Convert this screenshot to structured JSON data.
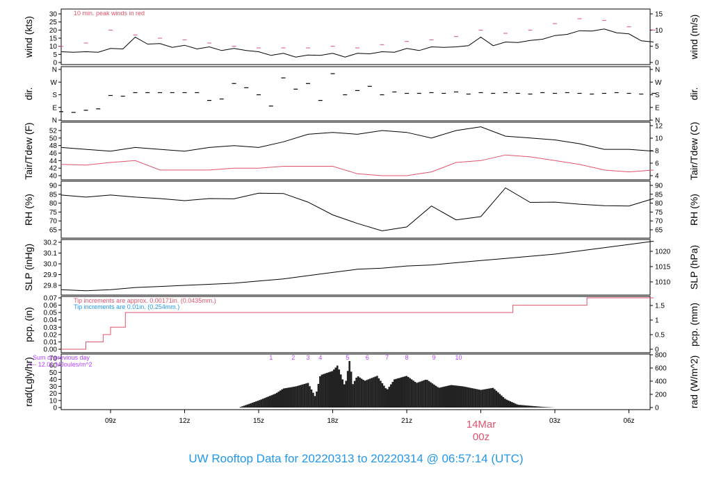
{
  "title": "UW Rooftop Data for 20220313  to  20220314 @ 06:57:14  (UTC)",
  "colors": {
    "black": "#000000",
    "red": "#DF536B",
    "blue": "#2297E6",
    "purple": "#B643FF",
    "title": "#2297E6"
  },
  "chart_data": {
    "type": "line",
    "x_unit": "hours since 2022-03-13 07z",
    "xlim": [
      0,
      24
    ],
    "x_ticks": [
      {
        "h": 2,
        "label": "09z"
      },
      {
        "h": 5,
        "label": "12z"
      },
      {
        "h": 8,
        "label": "15z"
      },
      {
        "h": 11,
        "label": "18z"
      },
      {
        "h": 14,
        "label": "21z"
      },
      {
        "h": 17,
        "label": "00z"
      },
      {
        "h": 20,
        "label": "03z"
      },
      {
        "h": 23,
        "label": "06z"
      }
    ],
    "date_marker": {
      "h": 17,
      "date": "14Mar",
      "time": "00z"
    },
    "panels": [
      {
        "id": "wind",
        "ylabel": "wind (kts)",
        "ylabel_right": "wind (m/s)",
        "left_ticks": [
          "0",
          "5",
          "10",
          "15",
          "20",
          "25",
          "30"
        ],
        "left_values": [
          0,
          5,
          10,
          15,
          20,
          25,
          30
        ],
        "right_ticks": [
          "0",
          "5",
          "10",
          "15"
        ],
        "right_values": [
          0,
          5,
          10,
          15
        ],
        "annotation": "10 min. peak winds in red",
        "series": [
          {
            "name": "wind speed (kts)",
            "color": "black",
            "dx": 0.5,
            "values": [
              6,
              7,
              6,
              7,
              8,
              9,
              15,
              12,
              11,
              10,
              10,
              9,
              9,
              8,
              8,
              8,
              6,
              5,
              5,
              4,
              4,
              5,
              5,
              4,
              5,
              6,
              6,
              7,
              8,
              8,
              9,
              10,
              9,
              11,
              15,
              11,
              12,
              13,
              13,
              15,
              16,
              18,
              19,
              20,
              20,
              19,
              17,
              14,
              12
            ]
          },
          {
            "name": "10 min peak (kts)",
            "color": "red",
            "dx": 1,
            "values": [
              10,
              12,
              20,
              17,
              15,
              14,
              12,
              10,
              9,
              9,
              9,
              10,
              9,
              11,
              13,
              14,
              16,
              20,
              18,
              20,
              24,
              27,
              26,
              22,
              20
            ]
          }
        ]
      },
      {
        "id": "dir",
        "ylabel": "dir.",
        "ylabel_right": "dir.",
        "left_ticks": [
          "N",
          "E",
          "S",
          "W",
          "N"
        ],
        "left_values": [
          0,
          90,
          180,
          270,
          360
        ],
        "right_ticks": [
          "N",
          "E",
          "S",
          "W",
          "N"
        ],
        "right_values": [
          0,
          90,
          180,
          270,
          360
        ],
        "series": [
          {
            "name": "direction (deg)",
            "color": "black",
            "dx": 0.5,
            "values": [
              60,
              55,
              70,
              80,
              175,
              170,
              195,
              195,
              195,
              195,
              195,
              195,
              140,
              150,
              260,
              230,
              180,
              100,
              300,
              220,
              260,
              140,
              330,
              180,
              210,
              240,
              180,
              200,
              190,
              190,
              195,
              190,
              200,
              185,
              195,
              190,
              195,
              190,
              185,
              195,
              190,
              195,
              190,
              185,
              190,
              195,
              190,
              185,
              190
            ]
          }
        ]
      },
      {
        "id": "temp",
        "ylabel": "Tair/Tdew (F)",
        "ylabel_right": "Tair/Tdew (C)",
        "left_ticks": [
          "40",
          "42",
          "44",
          "46",
          "48",
          "50",
          "52"
        ],
        "left_values": [
          40,
          42,
          44,
          46,
          48,
          50,
          52
        ],
        "right_ticks": [
          "4",
          "6",
          "8",
          "10",
          "12"
        ],
        "right_values": [
          4,
          6,
          8,
          10,
          12
        ],
        "series": [
          {
            "name": "Tair (F)",
            "color": "black",
            "dx": 1,
            "values": [
              47.5,
              47,
              46.5,
              47.5,
              47,
              46.5,
              47.5,
              48,
              47.5,
              49,
              51,
              51.5,
              51,
              52,
              51.5,
              50,
              52,
              53,
              50.5,
              50,
              49.5,
              48.5,
              47,
              47,
              46.5
            ]
          },
          {
            "name": "Tdew (F)",
            "color": "red",
            "dx": 1,
            "values": [
              43,
              42.8,
              43.5,
              44,
              41.5,
              41.5,
              41.5,
              42,
              42,
              42.5,
              42.5,
              42.5,
              40.5,
              40,
              40,
              41,
              43.5,
              44,
              45.5,
              45,
              44,
              43,
              41.5,
              41,
              41.5
            ]
          }
        ]
      },
      {
        "id": "rh",
        "ylabel": "RH (%)",
        "ylabel_right": "RH (%)",
        "left_ticks": [
          "65",
          "70",
          "75",
          "80",
          "85",
          "90"
        ],
        "left_values": [
          65,
          70,
          75,
          80,
          85,
          90
        ],
        "right_ticks": [
          "65",
          "70",
          "75",
          "80",
          "85",
          "90"
        ],
        "right_values": [
          65,
          70,
          75,
          80,
          85,
          90
        ],
        "series": [
          {
            "name": "RH (%)",
            "color": "black",
            "dx": 1,
            "values": [
              84,
              84,
              84,
              84,
              82,
              82,
              82,
              83,
              85,
              86,
              80,
              74,
              68,
              65,
              66,
              79,
              70,
              73,
              88,
              81,
              80,
              80,
              78,
              79,
              82
            ]
          }
        ]
      },
      {
        "id": "slp",
        "ylabel": "SLP (inHg)",
        "ylabel_right": "SLP (hPa)",
        "left_ticks": [
          "29.8",
          "29.9",
          "30.0",
          "30.1",
          "30.2"
        ],
        "left_values": [
          29.8,
          29.9,
          30.0,
          30.1,
          30.2
        ],
        "right_ticks": [
          "1010",
          "1015",
          "1020"
        ],
        "right_values": [
          1010,
          1015,
          1020
        ],
        "series": [
          {
            "name": "SLP (inHg)",
            "color": "black",
            "dx": 1,
            "values": [
              29.76,
              29.75,
              29.76,
              29.78,
              29.79,
              29.8,
              29.81,
              29.82,
              29.84,
              29.86,
              29.89,
              29.92,
              29.95,
              29.96,
              29.98,
              29.99,
              30.01,
              30.03,
              30.05,
              30.07,
              30.09,
              30.12,
              30.15,
              30.18,
              30.21
            ]
          }
        ]
      },
      {
        "id": "pcp",
        "ylabel": "pcp. (in)",
        "ylabel_right": "pcp. (mm)",
        "left_ticks": [
          "0.00",
          "0.01",
          "0.02",
          "0.03",
          "0.04",
          "0.05",
          "0.06",
          "0.07"
        ],
        "left_values": [
          0,
          0.01,
          0.02,
          0.03,
          0.04,
          0.05,
          0.06,
          0.07
        ],
        "right_ticks": [
          "0",
          "0.5",
          "1",
          "1.5"
        ],
        "right_values": [
          0,
          0.5,
          1,
          1.5
        ],
        "annotation_red": "Tip increments are approx. 0.00171in. (0.0435mm.)",
        "annotation_blue": "Tip increments are 0.01in. (0.254mm.)",
        "steps": [
          {
            "h": 0,
            "v": 0
          },
          {
            "h": 1.0,
            "v": 0.01
          },
          {
            "h": 1.7,
            "v": 0.02
          },
          {
            "h": 2.0,
            "v": 0.03
          },
          {
            "h": 2.6,
            "v": 0.05
          },
          {
            "h": 18.3,
            "v": 0.06
          },
          {
            "h": 21.3,
            "v": 0.07
          },
          {
            "h": 24,
            "v": 0.07
          }
        ]
      },
      {
        "id": "rad",
        "ylabel": "rad(Lgly/hr)",
        "ylabel_right": "rad (W/m^2)",
        "left_ticks": [
          "0",
          "10",
          "20",
          "30",
          "40",
          "50",
          "60",
          "70"
        ],
        "left_values": [
          0,
          10,
          20,
          30,
          40,
          50,
          60,
          70
        ],
        "right_ticks": [
          "0",
          "200",
          "400",
          "600",
          "800"
        ],
        "right_values": [
          0,
          200,
          400,
          600,
          800
        ],
        "annotation_line1": "Sum of previous day",
        "annotation_line2": "<-- 12.01 MJoules/m^2",
        "hour_marks": [
          "1",
          "2",
          "3",
          "4",
          "5",
          "6",
          "7",
          "8",
          "9",
          "10"
        ],
        "hour_marks_h": [
          8.5,
          9.4,
          10,
          10.5,
          11.6,
          12.4,
          13.2,
          14,
          15.1,
          16.1
        ],
        "points": [
          [
            7.2,
            0
          ],
          [
            8,
            10
          ],
          [
            8.7,
            20
          ],
          [
            9,
            27
          ],
          [
            9.5,
            30
          ],
          [
            10,
            35
          ],
          [
            10.3,
            15
          ],
          [
            10.5,
            46
          ],
          [
            11,
            52
          ],
          [
            11.2,
            60
          ],
          [
            11.5,
            30
          ],
          [
            11.7,
            70
          ],
          [
            11.8,
            32
          ],
          [
            12,
            45
          ],
          [
            12.3,
            38
          ],
          [
            12.8,
            45
          ],
          [
            13.2,
            25
          ],
          [
            13.5,
            40
          ],
          [
            14,
            45
          ],
          [
            14.4,
            35
          ],
          [
            14.8,
            40
          ],
          [
            15.3,
            28
          ],
          [
            15.8,
            32
          ],
          [
            16.3,
            30
          ],
          [
            17,
            25
          ],
          [
            17.5,
            28
          ],
          [
            18,
            12
          ],
          [
            18.5,
            4
          ],
          [
            19.5,
            1
          ],
          [
            20,
            0
          ]
        ]
      }
    ]
  }
}
